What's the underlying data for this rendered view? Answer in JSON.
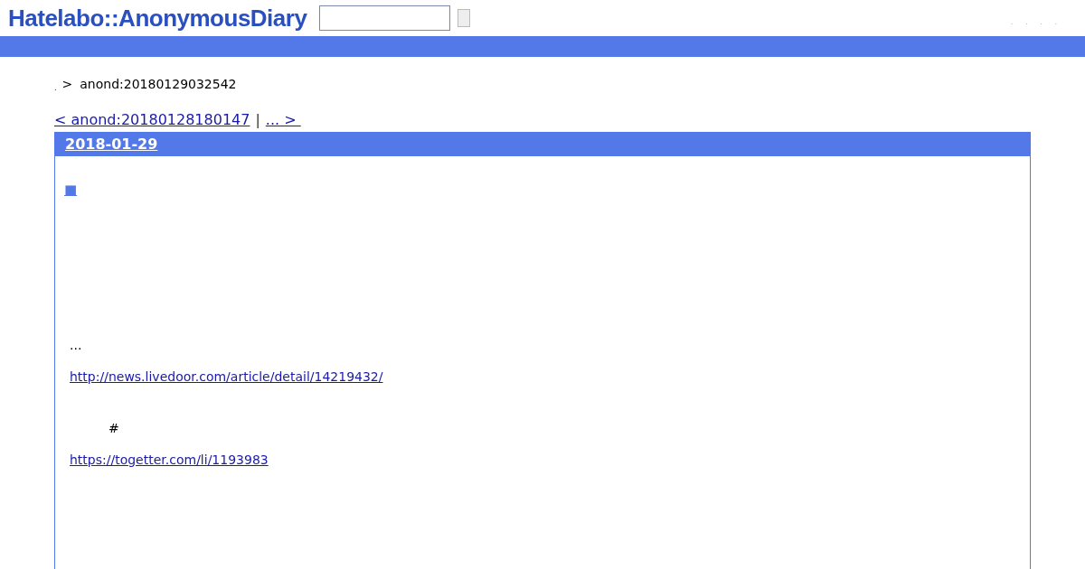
{
  "header": {
    "logo": "Hatelabo::AnonymousDiary",
    "links": [
      ".",
      ".",
      ".",
      "."
    ]
  },
  "breadcrumb": {
    "home": ".",
    "separator": ">",
    "current": "anond:20180129032542"
  },
  "pager": {
    "prev": "< anond:20180128180147",
    "divider": "|",
    "next": "... > "
  },
  "entry": {
    "date": "2018-01-29",
    "title_mark": "■",
    "body": [
      {
        "kind": "text",
        "text": "..."
      },
      {
        "kind": "link",
        "text": "http://news.livedoor.com/article/detail/14219432/"
      },
      {
        "kind": "indented",
        "text": "#"
      },
      {
        "kind": "link",
        "text": "https://togetter.com/li/1193983"
      }
    ]
  }
}
